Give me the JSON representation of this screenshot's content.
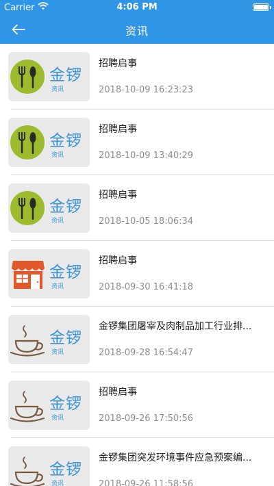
{
  "status_bar": {
    "carrier": "Carrier",
    "time": "4:06 PM"
  },
  "nav": {
    "title": "资讯",
    "back_icon": "arrow-left-icon"
  },
  "colors": {
    "header": "#2f95e6",
    "brand": "#3b97d6"
  },
  "thumb_text": {
    "brand": "金锣",
    "sub": "资讯"
  },
  "items": [
    {
      "icon": "utensils-icon",
      "title": "招聘启事",
      "date": "2018-10-09 16:23:23"
    },
    {
      "icon": "utensils-icon",
      "title": "招聘启事",
      "date": "2018-10-09 13:40:29"
    },
    {
      "icon": "utensils-icon",
      "title": "招聘启事",
      "date": "2018-10-05 18:06:34"
    },
    {
      "icon": "store-icon",
      "title": "招聘启事",
      "date": "2018-09-30 16:41:18"
    },
    {
      "icon": "coffee-cup-icon",
      "title": "金锣集团屠宰及肉制品加工行业排...",
      "date": "2018-09-28 16:54:47"
    },
    {
      "icon": "coffee-cup-icon",
      "title": "招聘启事",
      "date": "2018-09-26 17:50:56"
    },
    {
      "icon": "coffee-cup-icon",
      "title": "金锣集团突发环境事件应急预案编...",
      "date": "2018-09-26 11:58:56"
    }
  ]
}
